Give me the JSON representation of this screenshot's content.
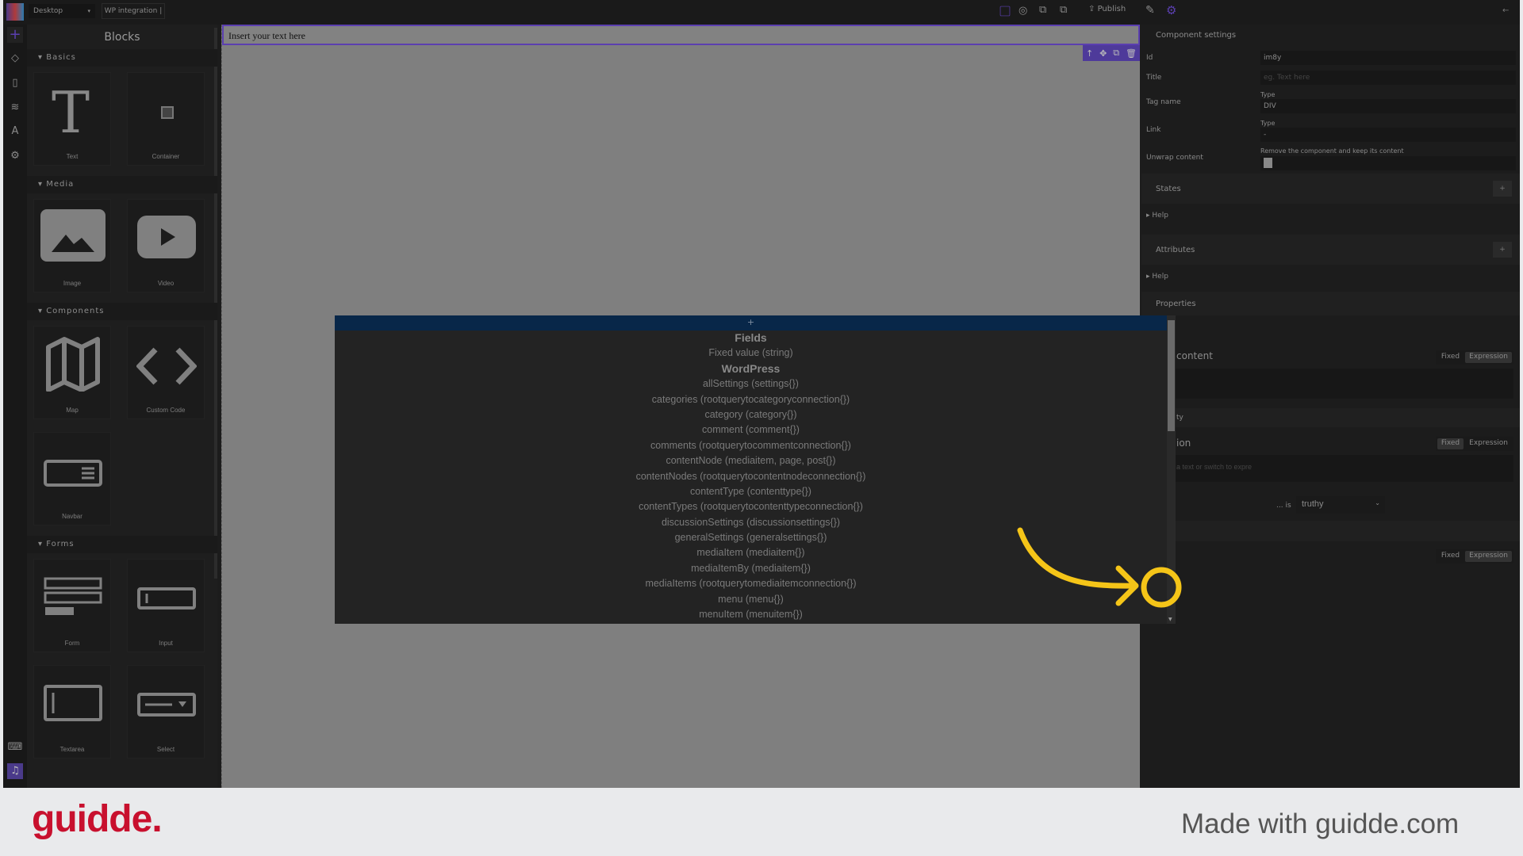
{
  "topbar": {
    "device": "Desktop",
    "page_name": "WP integration |",
    "publish": "Publish"
  },
  "blocks": {
    "title": "Blocks",
    "sections": [
      {
        "name": "Basics",
        "items": [
          "Text",
          "Container"
        ]
      },
      {
        "name": "Media",
        "items": [
          "Image",
          "Video"
        ]
      },
      {
        "name": "Components",
        "items": [
          "Map",
          "Custom Code",
          "Navbar"
        ]
      },
      {
        "name": "Forms",
        "items": [
          "Form",
          "Input",
          "Textarea",
          "Select"
        ]
      }
    ]
  },
  "canvas": {
    "text": "Insert your text here"
  },
  "dropdown": {
    "add": "+",
    "groups": [
      {
        "title": "Fields",
        "items": [
          "Fixed value (string)"
        ]
      },
      {
        "title": "WordPress",
        "items": [
          "allSettings (settings{})",
          "categories (rootquerytocategoryconnection{})",
          "category (category{})",
          "comment (comment{})",
          "comments (rootquerytocommentconnection{})",
          "contentNode (mediaitem, page, post{})",
          "contentNodes (rootquerytocontentnodeconnection{})",
          "contentType (contenttype{})",
          "contentTypes (rootquerytocontenttypeconnection{})",
          "discussionSettings (discussionsettings{})",
          "generalSettings (generalsettings{})",
          "mediaItem (mediaitem{})",
          "mediaItemBy (mediaitem{})",
          "mediaItems (rootquerytomediaitemconnection{})",
          "menu (menu{})",
          "menuItem (menuitem{})"
        ]
      }
    ]
  },
  "settings": {
    "title": "Component settings",
    "id_label": "Id",
    "id_value": "im8y",
    "title_label": "Title",
    "title_placeholder": "eg. Text here",
    "tag_label": "Tag name",
    "type_label": "Type",
    "tag_value": "DIV",
    "link_label": "Link",
    "link_value": "-",
    "unwrap_label": "Unwrap content",
    "unwrap_hint": "Remove the component and keep its content",
    "states": "States",
    "help": "Help",
    "attributes": "Attributes",
    "properties": "Properties",
    "plus": "+",
    "content_label": "content",
    "ty_label": "ty",
    "ion_label": "ion",
    "expr_placeholder": "a text or switch to expre",
    "is_label": "... is",
    "is_value": "truthy",
    "fixed": "Fixed",
    "expression": "Expression"
  },
  "footer": {
    "logo": "guidde.",
    "made_with": "Made with guidde.com"
  },
  "colors": {
    "accent": "#5b3fb0",
    "highlight": "#f5c518",
    "brand": "#c8102e"
  }
}
